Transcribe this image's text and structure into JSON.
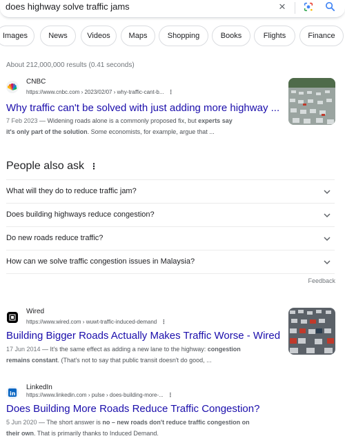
{
  "search": {
    "query": "does highway solve traffic jams",
    "clear_glyph": "×"
  },
  "chips": [
    "Images",
    "News",
    "Videos",
    "Maps",
    "Shopping",
    "Books",
    "Flights",
    "Finance"
  ],
  "stats": "About 212,000,000 results (0.41 seconds)",
  "results": [
    {
      "source": "CNBC",
      "url": "https://www.cnbc.com › 2023/02/07 › why-traffic-cant-b...",
      "title": "Why traffic can't be solved with just adding more highway ...",
      "date": "7 Feb 2023",
      "snippet_1a": " — Widening roads alone is a commonly proposed fix, but ",
      "snippet_1b": "experts say",
      "snippet_2a": "it's only part of the solution",
      "snippet_2b": ". Some economists, for example, argue that ..."
    },
    {
      "source": "Wired",
      "url": "https://www.wired.com › wuwt-traffic-induced-demand",
      "title": "Building Bigger Roads Actually Makes Traffic Worse - Wired",
      "date": "17 Jun 2014",
      "snippet_1a": " — It's the same effect as adding a new lane to the highway: ",
      "snippet_1b": "congestion",
      "snippet_2a": "remains constant",
      "snippet_2b": ". (That's not to say that public transit doesn't do good, ..."
    },
    {
      "source": "LinkedIn",
      "url": "https://www.linkedin.com › pulse › does-building-more-...",
      "title": "Does Building More Roads Reduce Traffic Congestion?",
      "date": "5 Jun 2020",
      "snippet_1a": " — The short answer is ",
      "snippet_1b": "no – new roads don't reduce traffic congestion on",
      "snippet_2a": "their own",
      "snippet_2b": ". That is primarily thanks to Induced Demand."
    }
  ],
  "people_also_ask": {
    "title": "People also ask",
    "menu_glyph": "⋮",
    "questions": [
      "What will they do to reduce traffic jam?",
      "Does building highways reduce congestion?",
      "Do new roads reduce traffic?",
      "How can we solve traffic congestion issues in Malaysia?"
    ],
    "feedback": "Feedback"
  },
  "result_menu_glyph": "⋮",
  "colors": {
    "link": "#1a0dab",
    "text": "#202124",
    "muted": "#4d5156"
  },
  "icons": {
    "clear": "close-icon",
    "lens": "google-lens-icon",
    "search": "search-icon",
    "expand": "chevron-down-icon"
  }
}
